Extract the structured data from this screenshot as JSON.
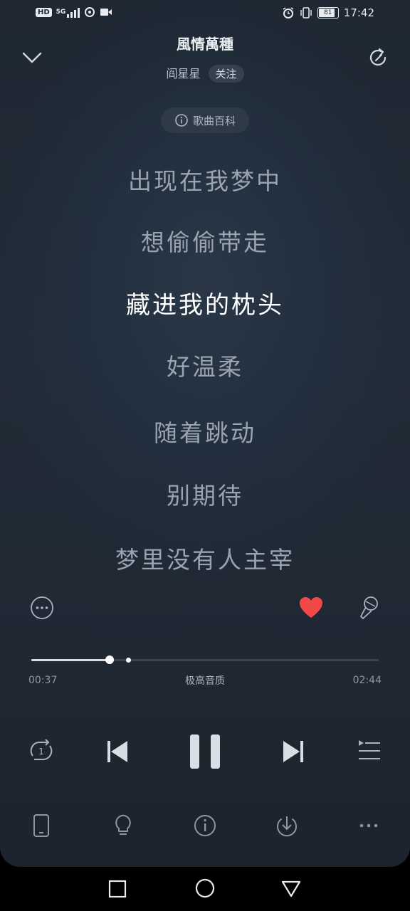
{
  "status_bar": {
    "hd": "HD",
    "network": "5G",
    "battery": "81",
    "time": "17:42"
  },
  "header": {
    "song_title": "風情萬種",
    "artist": "阎星星",
    "follow_label": "关注",
    "wiki_label": "歌曲百科"
  },
  "lyrics": [
    "出现在我梦中",
    "想偷偷带走",
    "藏进我的枕头",
    "好温柔",
    "随着跳动",
    "别期待",
    "梦里没有人主宰"
  ],
  "active_lyric_index": 2,
  "player": {
    "elapsed": "00:37",
    "duration": "02:44",
    "quality": "极高音质",
    "progress": 0.226,
    "buffered": 0.28,
    "liked": true,
    "like_color": "#f24848"
  },
  "icons": {
    "back": "chevron-down-icon",
    "share": "refresh-share-icon",
    "more": "more-icon",
    "heart": "heart-icon",
    "mic": "microphone-icon",
    "repeat": "repeat-one-icon",
    "prev": "previous-icon",
    "pause": "pause-icon",
    "next": "next-icon",
    "playlist": "playlist-icon",
    "device": "phone-device-icon",
    "light": "lightbulb-icon",
    "info": "info-icon",
    "download": "download-icon",
    "menu": "ellipsis-icon"
  }
}
